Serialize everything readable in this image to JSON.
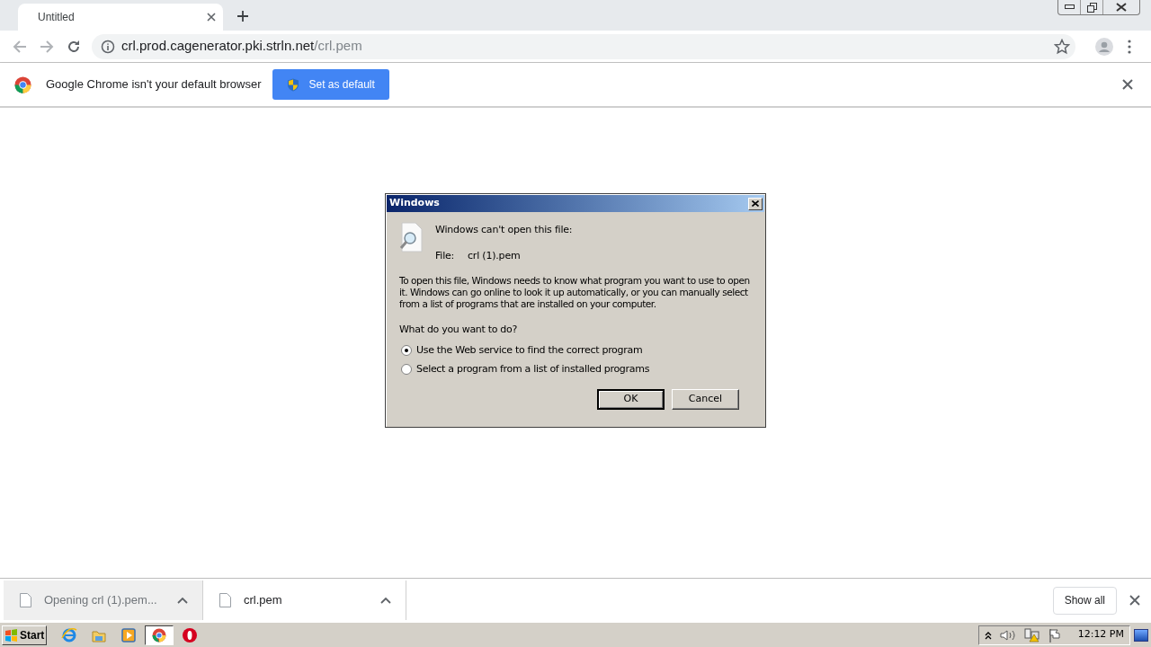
{
  "browser": {
    "tabs": [
      {
        "title": "Untitled",
        "selected": true
      }
    ],
    "url_host": "crl.prod.cagenerator.pki.strln.net",
    "url_path": "/crl.pem"
  },
  "infobar": {
    "message": "Google Chrome isn't your default browser",
    "button": "Set as default"
  },
  "dialog": {
    "title": "Windows",
    "heading": "Windows can't open this file:",
    "file_label": "File:",
    "file_name": "crl (1).pem",
    "body": "To open this file, Windows needs to know what program you want to use to open it. Windows can go online to look it up automatically, or you can manually select from a list of programs that are installed on your computer.",
    "question": "What do you want to do?",
    "options": [
      {
        "label": "Use the Web service to find the correct program",
        "selected": true
      },
      {
        "label": "Select a program from a list of installed programs",
        "selected": false
      }
    ],
    "buttons": [
      {
        "label": "OK",
        "default": true
      },
      {
        "label": "Cancel",
        "default": false
      }
    ]
  },
  "downloads": {
    "items": [
      {
        "label": "Opening crl (1).pem...",
        "active": true
      },
      {
        "label": "crl.pem",
        "active": false
      }
    ],
    "show_all": "Show all"
  },
  "taskbar": {
    "start": "Start",
    "apps": [
      {
        "kind": "ie",
        "selected": false
      },
      {
        "kind": "explorer",
        "selected": false
      },
      {
        "kind": "media",
        "selected": false
      },
      {
        "kind": "chrome",
        "selected": true
      },
      {
        "kind": "opera",
        "selected": false
      }
    ],
    "clock": "12:12 PM"
  }
}
